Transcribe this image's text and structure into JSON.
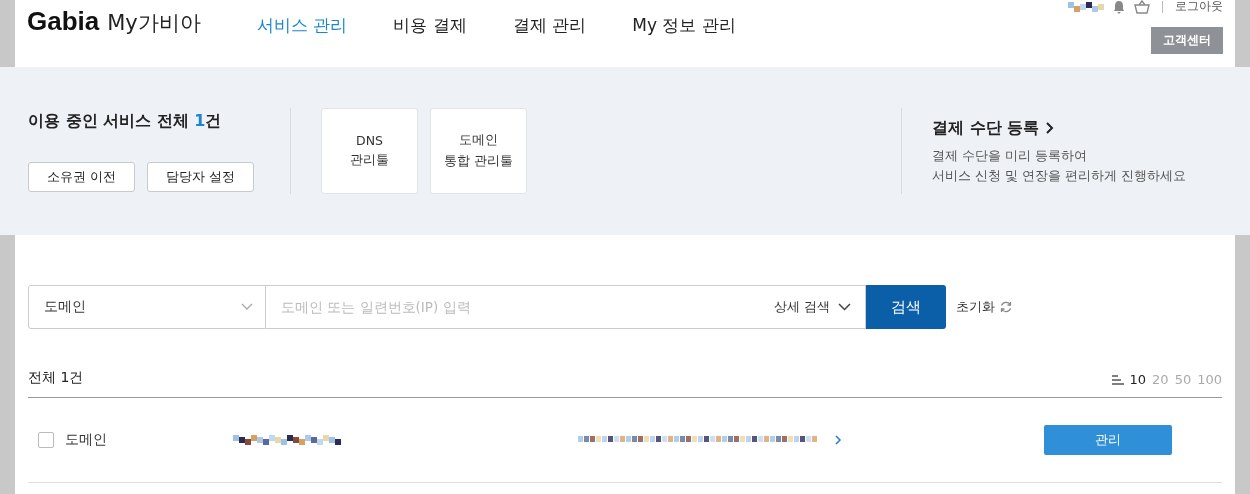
{
  "header": {
    "logo": "Gabia",
    "logo_sub": "My가비아",
    "nav": [
      {
        "label": "서비스 관리",
        "selected": true
      },
      {
        "label": "비용 결제",
        "selected": false
      },
      {
        "label": "결제 관리",
        "selected": false
      },
      {
        "label": "My 정보 관리",
        "selected": false
      }
    ],
    "logout": "로그아웃",
    "support_button": "고객센터"
  },
  "summary": {
    "title_prefix": "이용 중인 서비스 전체 ",
    "count": "1",
    "title_suffix": "건",
    "buttons": [
      "소유권 이전",
      "담당자 설정"
    ],
    "tools": [
      {
        "lines": [
          "DNS",
          "관리툴"
        ]
      },
      {
        "lines": [
          "도메인",
          "통합 관리툴"
        ]
      }
    ],
    "payment": {
      "title": "결제 수단 등록",
      "lines": [
        "결제 수단을 미리 등록하여",
        "서비스 신청 및 연장을 편리하게 진행하세요"
      ]
    }
  },
  "search": {
    "category": "도메인",
    "placeholder": "도메인 또는 일련번호(IP) 입력",
    "advanced": "상세 검색",
    "button": "검색",
    "reset": "초기화"
  },
  "list": {
    "total": "전체 1건",
    "page_sizes": [
      {
        "label": "10",
        "selected": true
      },
      {
        "label": "20",
        "selected": false
      },
      {
        "label": "50",
        "selected": false
      },
      {
        "label": "100",
        "selected": false
      }
    ],
    "rows": [
      {
        "checked": false,
        "type": "도메인",
        "action": "관리"
      }
    ]
  }
}
